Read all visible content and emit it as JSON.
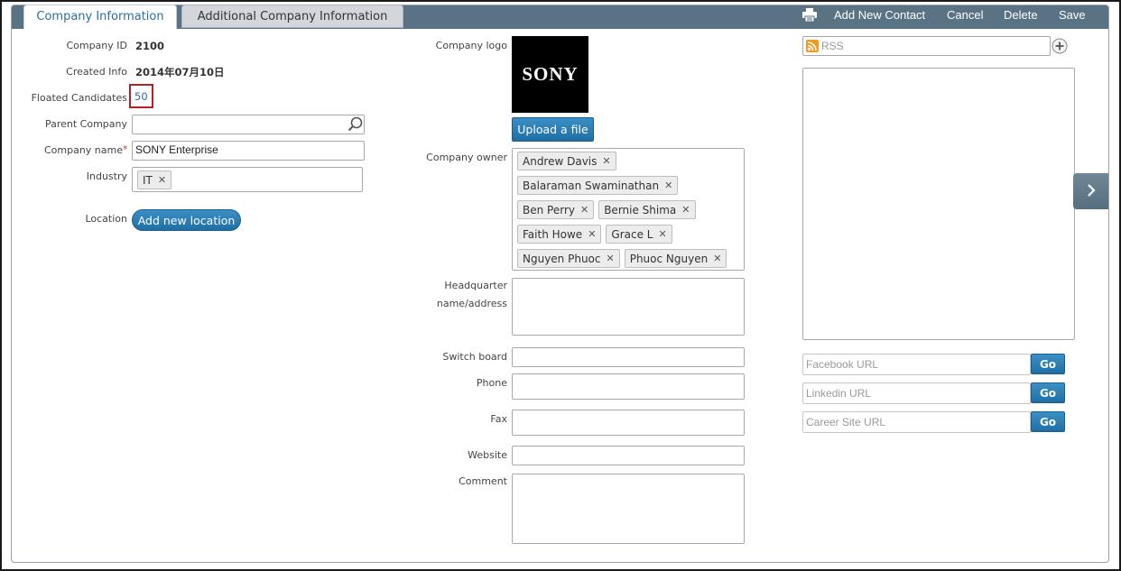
{
  "tabs": [
    {
      "label": "Company Information"
    },
    {
      "label": "Additional Company Information"
    }
  ],
  "toolbar": {
    "add_new_contact": "Add New Contact",
    "cancel": "Cancel",
    "delete": "Delete",
    "save": "Save"
  },
  "left": {
    "company_id_label": "Company ID",
    "company_id_value": "2100",
    "created_info_label": "Created Info",
    "created_info_value": "2014年07月10日",
    "floated_candidates_label": "Floated Candidates",
    "floated_candidates_value": "50",
    "parent_company_label": "Parent Company",
    "parent_company_value": "",
    "company_name_label": "Company name",
    "required_mark": "*",
    "company_name_value": "SONY Enterprise",
    "industry_label": "Industry",
    "industry_chips": [
      "IT"
    ],
    "location_label": "Location",
    "add_location_button": "Add new location"
  },
  "middle": {
    "company_logo_label": "Company logo",
    "logo_text": "SONY",
    "upload_button": "Upload a file",
    "company_owner_label": "Company owner",
    "owners": [
      "Andrew Davis",
      "Balaraman Swaminathan",
      "Ben Perry",
      "Bernie Shima",
      "Faith Howe",
      "Grace L",
      "Nguyen Phuoc",
      "Phuoc Nguyen"
    ],
    "hq_label_line1": "Headquarter",
    "hq_label_line2": "name/address",
    "switch_board_label": "Switch board",
    "phone_label": "Phone",
    "fax_label": "Fax",
    "website_label": "Website",
    "comment_label": "Comment"
  },
  "right": {
    "rss_placeholder": "RSS",
    "facebook_placeholder": "Facebook URL",
    "linkedin_placeholder": "Linkedin URL",
    "career_placeholder": "Career Site URL",
    "go_label": "Go"
  },
  "colors": {
    "tab_bar": "#597384",
    "button_blue": "#2a7db5",
    "highlight_box": "#b22222",
    "logo_bg": "#000000"
  }
}
